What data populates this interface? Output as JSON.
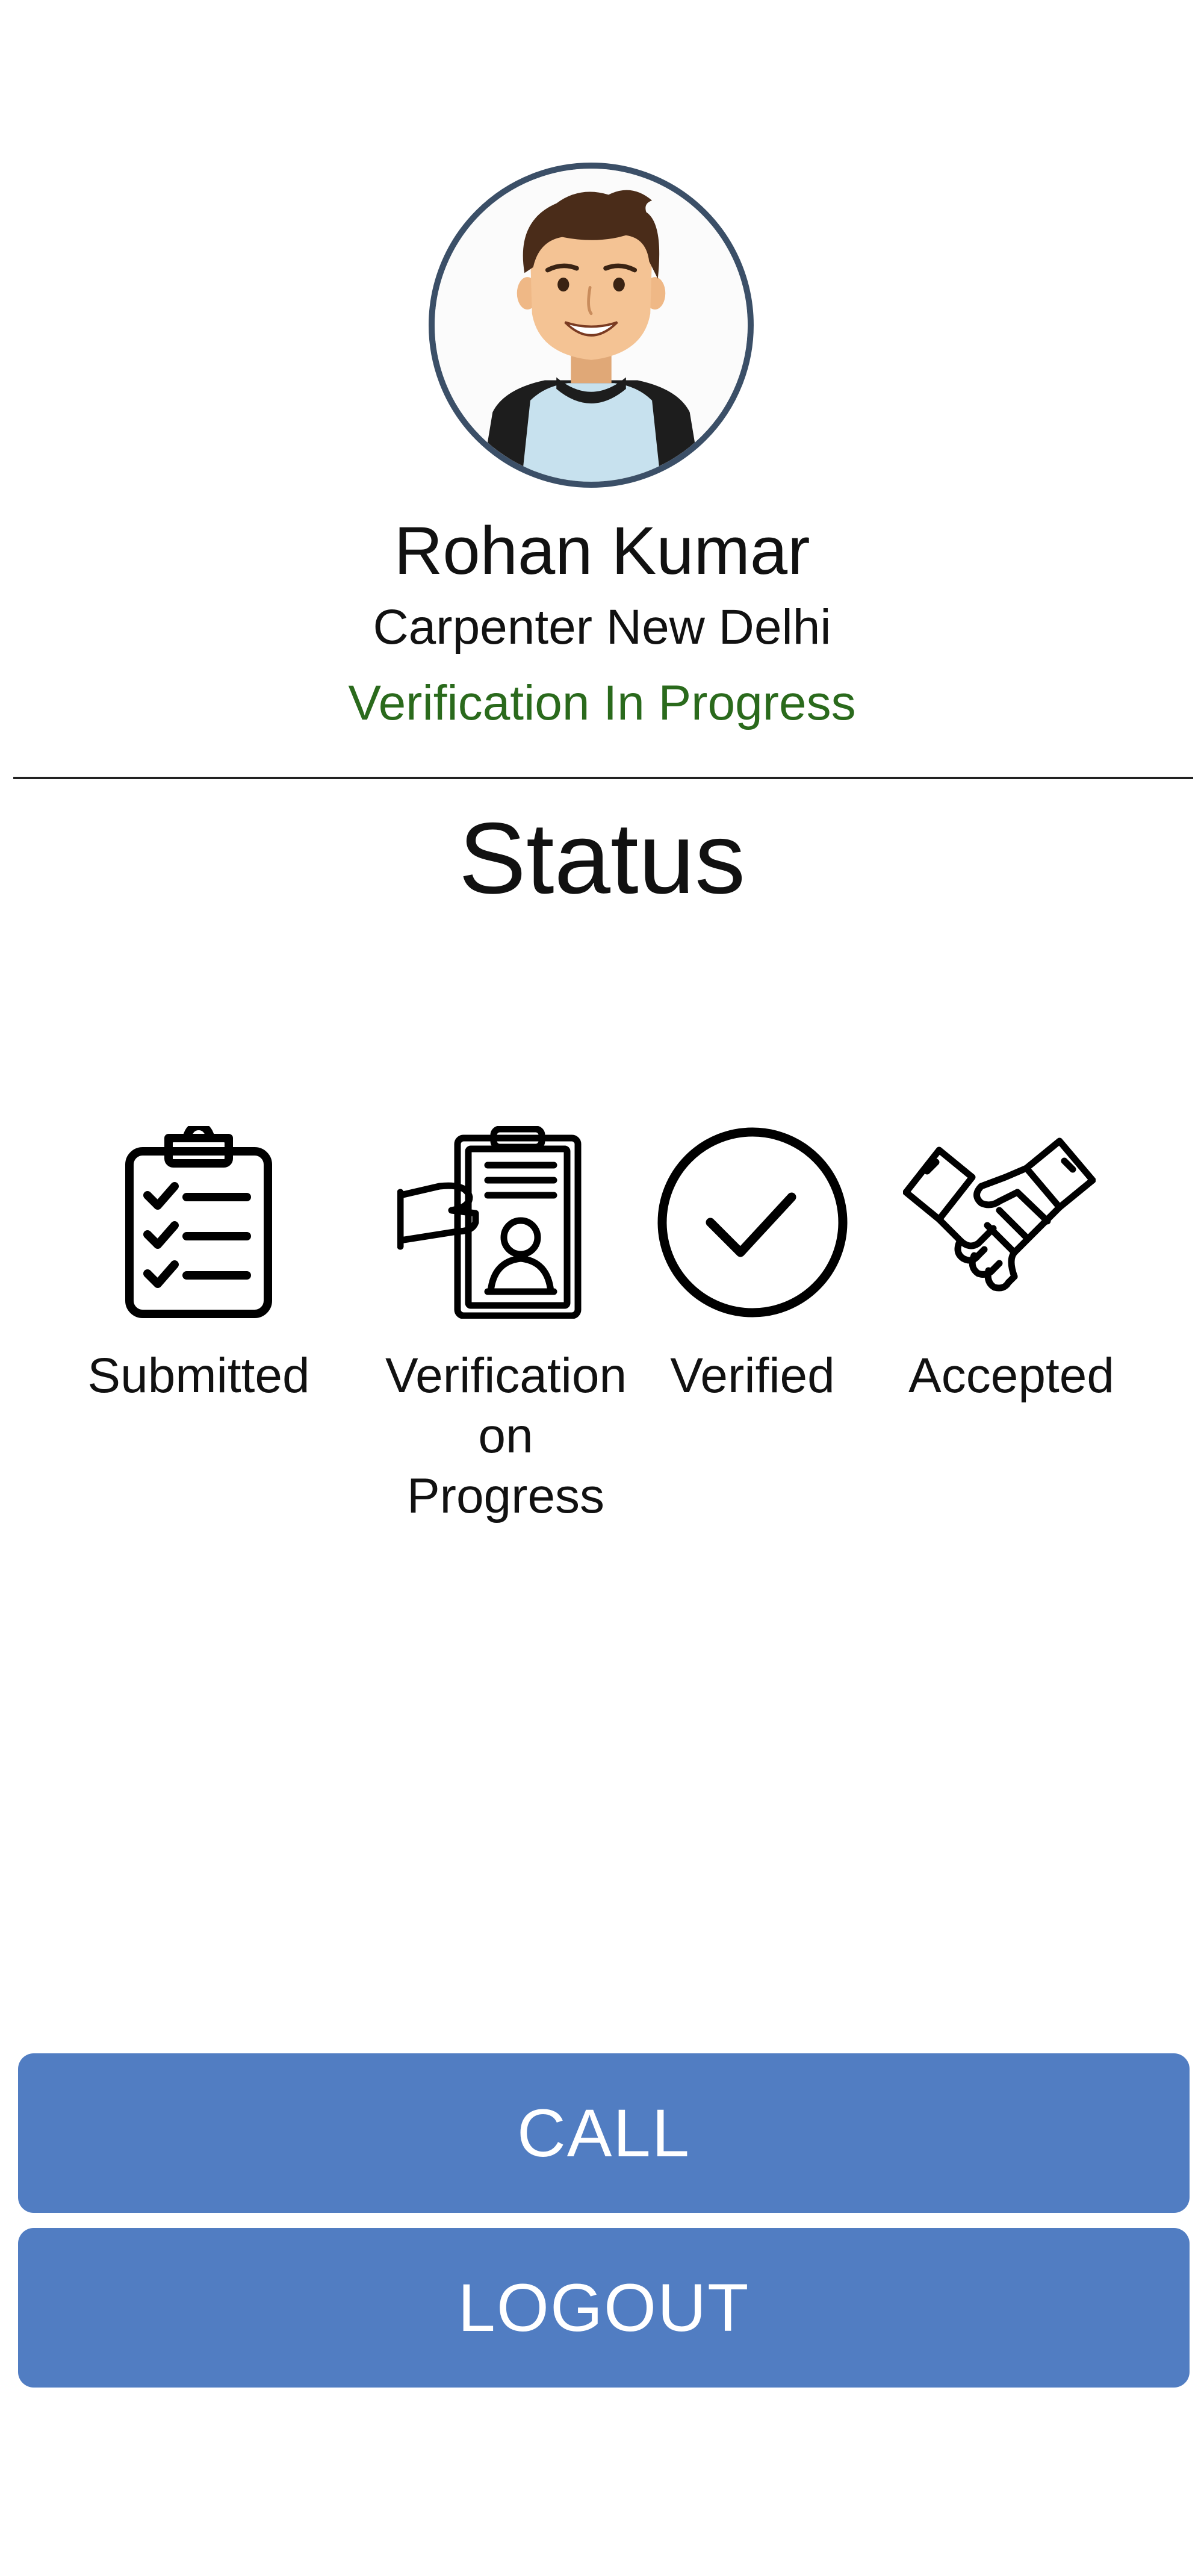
{
  "profile": {
    "name": "Rohan Kumar",
    "role_location": "Carpenter New Delhi",
    "verification_status": "Verification In Progress",
    "status_color": "#2a6a1c"
  },
  "status_section": {
    "title": "Status",
    "steps": [
      {
        "icon": "clipboard-checklist-icon",
        "label": "Submitted"
      },
      {
        "icon": "id-card-document-icon",
        "label": "Verification on Progress"
      },
      {
        "icon": "check-circle-icon",
        "label": "Verified"
      },
      {
        "icon": "handshake-icon",
        "label": "Accepted"
      }
    ]
  },
  "buttons": {
    "call": "CALL",
    "logout": "LOGOUT"
  },
  "colors": {
    "button": "#517dc2",
    "avatar_border": "#3b4f67"
  }
}
